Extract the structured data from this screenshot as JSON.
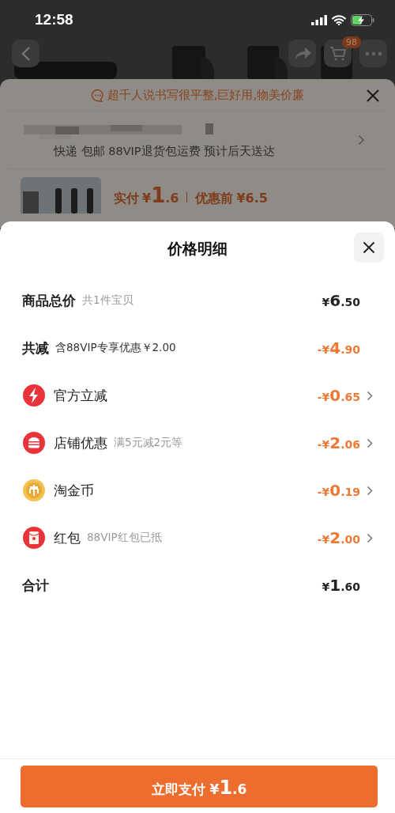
{
  "status_bar": {
    "time": "12:58"
  },
  "nav": {
    "cart_badge": "98"
  },
  "behind_sheet": {
    "review": "超千人说书写很平整,巨好用,物美价廉",
    "shipping": "快递 包邮 88VIP退货包运费 预计后天送达",
    "paid_label": "实付",
    "paid_price": "¥1.6",
    "before_label": "优惠前",
    "before_price": "¥6.5"
  },
  "title": "价格明细",
  "rows": [
    {
      "kind": "plain",
      "label": "商品总价",
      "note": "共1件宝贝",
      "amount": "¥6.50",
      "discount": false,
      "arrow": false
    },
    {
      "kind": "plain",
      "label": "共减",
      "note": "含88VIP专享优惠￥2.00",
      "amount": "-¥4.90",
      "discount": true,
      "arrow": false
    },
    {
      "kind": "bolt",
      "label": "官方立减",
      "amount": "-¥0.65",
      "discount": true,
      "arrow": true
    },
    {
      "kind": "shop",
      "label": "店铺优惠",
      "note": "满5元减2元等",
      "amount": "-¥2.06",
      "discount": true,
      "arrow": true
    },
    {
      "kind": "coin",
      "label": "淘金币",
      "amount": "-¥0.19",
      "discount": true,
      "arrow": true
    },
    {
      "kind": "envelope",
      "label": "红包",
      "note": "88VIP红包已抵",
      "amount": "-¥2.00",
      "discount": true,
      "arrow": true
    },
    {
      "kind": "plain",
      "label": "合计",
      "amount": "¥1.60",
      "discount": false,
      "arrow": false
    }
  ],
  "pay_button": "立即支付 ¥1.6"
}
